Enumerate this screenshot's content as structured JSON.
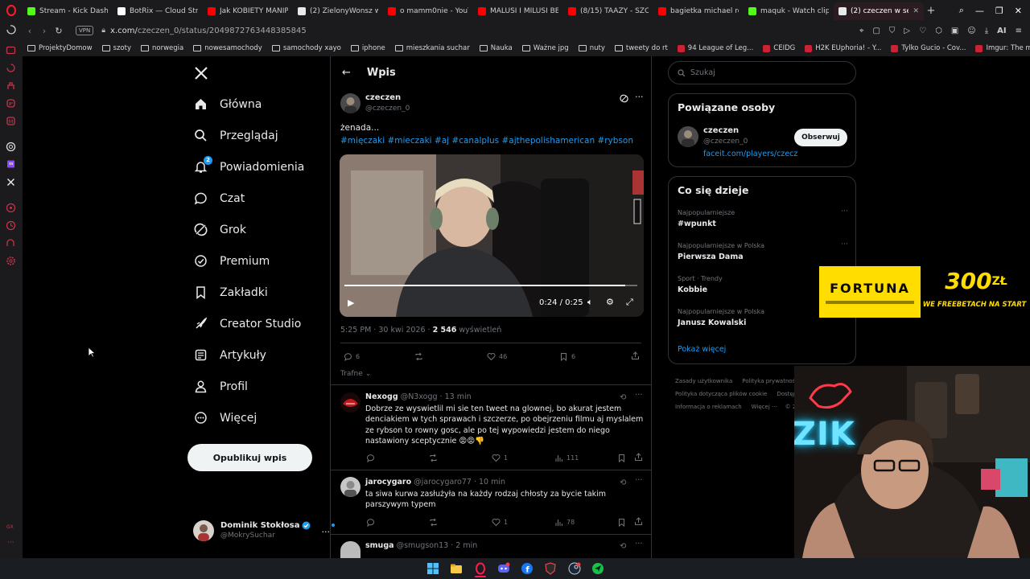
{
  "browser": {
    "tabs": [
      {
        "label": "Stream - Kick Dashbo",
        "color": "#53fc18"
      },
      {
        "label": "BotRix — Cloud Strea",
        "color": "#ffffff"
      },
      {
        "label": "Jak KOBIETY MANIPU",
        "color": "#ff0000"
      },
      {
        "label": "(2) ZielonyWonsz w s",
        "color": "#e7e9ea"
      },
      {
        "label": "o mamm0nie - YouTu",
        "color": "#ff0000"
      },
      {
        "label": "MALUSI I MILUSI BEZ",
        "color": "#ff0000"
      },
      {
        "label": "(8/15) TAAZY - SZCZ",
        "color": "#ff0000"
      },
      {
        "label": "bagietka michael robi",
        "color": "#ff0000"
      },
      {
        "label": "maquk - Watch clips",
        "color": "#53fc18"
      },
      {
        "label": "(2) czeczen w serwisie X:",
        "color": "#e7e9ea",
        "active": true
      }
    ],
    "url_host": "x.com/",
    "url_path": "czeczen_0/status/2049872763448385845",
    "vpn_label": "VPN",
    "bookmarks": [
      {
        "label": "ProjektyDomow",
        "type": "folder"
      },
      {
        "label": "szoty",
        "type": "folder"
      },
      {
        "label": "norwegia",
        "type": "folder"
      },
      {
        "label": "nowesamochody",
        "type": "folder"
      },
      {
        "label": "samochody xayo",
        "type": "folder"
      },
      {
        "label": "iphone",
        "type": "folder"
      },
      {
        "label": "mieszkania suchar",
        "type": "folder"
      },
      {
        "label": "Nauka",
        "type": "folder"
      },
      {
        "label": "Ważne jpg",
        "type": "folder"
      },
      {
        "label": "nuty",
        "type": "folder"
      },
      {
        "label": "tweety do rt",
        "type": "folder"
      },
      {
        "label": "94 League of Leg...",
        "type": "site"
      },
      {
        "label": "CEIDG",
        "type": "site"
      },
      {
        "label": "H2K EUphoria! - Y...",
        "type": "site"
      },
      {
        "label": "Tylko Gucio - Cov...",
        "type": "site"
      },
      {
        "label": "Imgur: The most a...",
        "type": "site"
      }
    ],
    "ai_label": "AI"
  },
  "nav": {
    "items": [
      {
        "label": "Główna",
        "icon": "home-icon"
      },
      {
        "label": "Przeglądaj",
        "icon": "search-icon"
      },
      {
        "label": "Powiadomienia",
        "icon": "bell-icon",
        "badge": "2"
      },
      {
        "label": "Czat",
        "icon": "chat-icon"
      },
      {
        "label": "Grok",
        "icon": "grok-icon"
      },
      {
        "label": "Premium",
        "icon": "premium-icon"
      },
      {
        "label": "Zakładki",
        "icon": "bookmark-icon"
      },
      {
        "label": "Creator Studio",
        "icon": "rocket-icon"
      },
      {
        "label": "Artykuły",
        "icon": "article-icon"
      },
      {
        "label": "Profil",
        "icon": "profile-icon"
      },
      {
        "label": "Więcej",
        "icon": "more-icon"
      }
    ],
    "post_button": "Opublikuj wpis",
    "account": {
      "name": "Dominik Stokłosa",
      "handle": "@MokrySuchar"
    }
  },
  "main": {
    "header_title": "Wpis",
    "post": {
      "author": "czeczen",
      "handle": "@czeczen_0",
      "text": "żenada...",
      "hashtags": "#mięczaki #mieczaki #aj #canalplus #ajthepolishamerican #rybson",
      "video_time": "0:24 / 0:25",
      "video_progress": 0.96,
      "timestamp": "5:25 PM · 30 kwi 2026 · ",
      "views_count": "2 546",
      "views_label": " wyświetleń",
      "replies": "6",
      "likes": "46",
      "bookmarks": "6"
    },
    "sort_label": "Trafne",
    "replies": [
      {
        "author": "Nexogg",
        "handle": "@N3xogg",
        "time": "· 13 min",
        "text": "Dobrze ze wyswietlil mi sie ten tweet na glownej, bo akurat jestem denciakiem w tych sprawach i szczerze, po obejrzeniu filmu aj myslalem ze rybson to rowny gosc, ale po tej wypowiedzi jestem do niego nastawiony sceptycznie 😡😡👎",
        "likes": "1",
        "views": "111"
      },
      {
        "author": "jarocygaro",
        "handle": "@jarocygaro77",
        "time": "· 10 min",
        "text": "ta siwa kurwa zasłużyła na każdy rodzaj chłosty za bycie takim parszywym typem",
        "likes": "1",
        "views": "78"
      },
      {
        "author": "smuga",
        "handle": "@smugson13",
        "time": "· 2 min"
      }
    ]
  },
  "right": {
    "search_placeholder": "Szukaj",
    "related_title": "Powiązane osoby",
    "related_person": {
      "name": "czeczen",
      "handle": "@czeczen_0",
      "link": "faceit.com/players/czecz"
    },
    "follow_label": "Obserwuj",
    "trends_title": "Co się dzieje",
    "trends": [
      {
        "context": "Najpopularniejsze",
        "name": "#wpunkt"
      },
      {
        "context": "Najpopularniejsze w Polska",
        "name": "Pierwsza Dama"
      },
      {
        "context": "Sport · Trendy",
        "name": "Kobbie"
      },
      {
        "context": "Najpopularniejsze w Polska",
        "name": "Janusz Kowalski"
      }
    ],
    "show_more": "Pokaż więcej",
    "footer": [
      [
        "Zasady użytkownika",
        "Polityka prywatności"
      ],
      [
        "Polityka dotycząca plików cookie",
        "Dostępność"
      ],
      [
        "Informacja o reklamach",
        "Więcej ···",
        "© 2"
      ]
    ]
  },
  "overlay": {
    "ad_brand": "FORTUNA",
    "ad_amount": "300",
    "ad_currency": "ZŁ",
    "ad_subtitle": "WE FREEBETACH NA START",
    "neon_text": "ZIK"
  }
}
